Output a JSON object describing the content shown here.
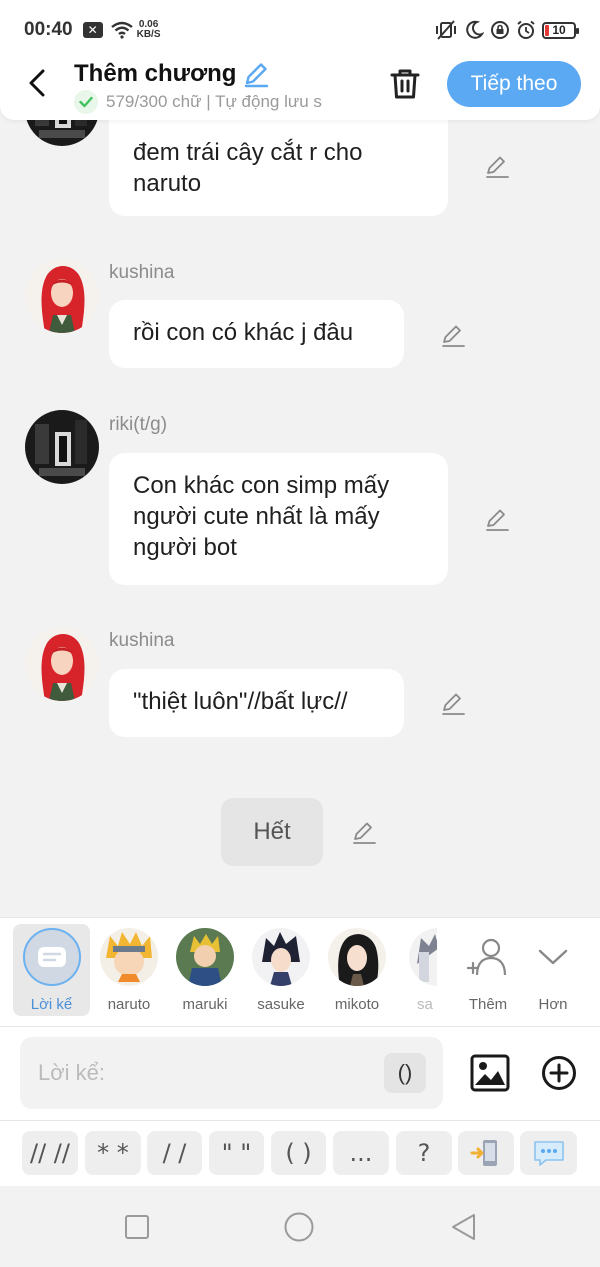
{
  "status_bar": {
    "time": "00:40",
    "net_speed_value": "0.06",
    "net_speed_unit": "KB/S",
    "battery": "10"
  },
  "header": {
    "title": "Thêm chương",
    "subtitle": "579/300 chữ | Tự động lưu s",
    "next_label": "Tiếp theo"
  },
  "messages": [
    {
      "sender": "",
      "text": "đem trái cây cắt r cho naruto",
      "avatar": "riki"
    },
    {
      "sender": "kushina",
      "text": "rồi con có khác j đâu",
      "avatar": "kushina"
    },
    {
      "sender": "riki(t/g)",
      "text": "Con khác con simp mấy người cute nhất là mấy người bot",
      "avatar": "riki"
    },
    {
      "sender": "kushina",
      "text": "\"thiệt luôn\"//bất lực//",
      "avatar": "kushina"
    }
  ],
  "end_label": "Hết",
  "characters": [
    {
      "label": "Lời kể",
      "selected": true
    },
    {
      "label": "naruto"
    },
    {
      "label": "maruki"
    },
    {
      "label": "sasuke"
    },
    {
      "label": "mikoto"
    },
    {
      "label": "sa"
    }
  ],
  "char_actions": {
    "add_label": "Thêm",
    "more_label": "Hơn"
  },
  "input": {
    "placeholder": "Lời kể:",
    "paren_label": "()"
  },
  "shortcuts": [
    "// //",
    "* *",
    "/ /",
    "\" \"",
    "( )",
    "...",
    "?"
  ],
  "colors": {
    "accent": "#5aa9f2",
    "background": "#f2f2f2",
    "bubble": "#ffffff",
    "check": "#43c35e"
  }
}
